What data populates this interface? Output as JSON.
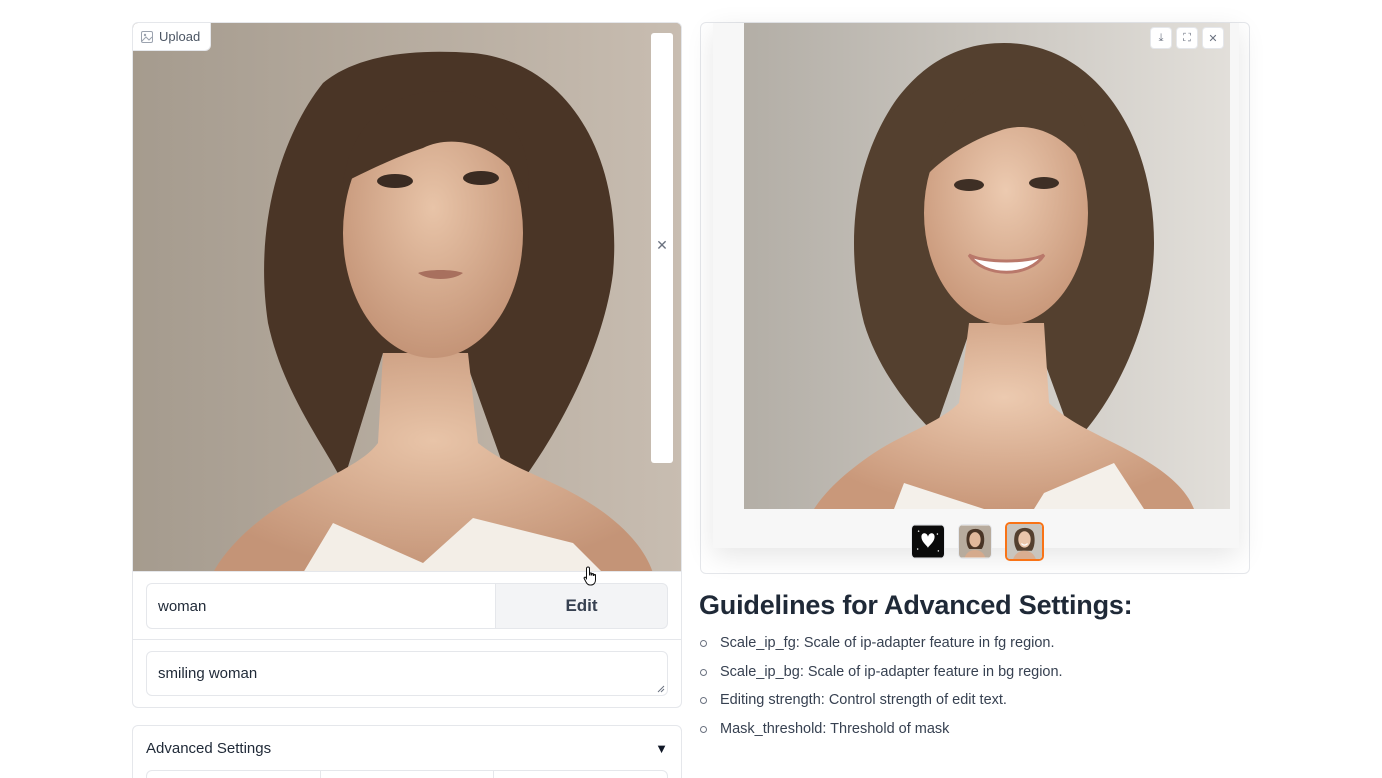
{
  "input_image": {
    "upload_label": "Upload",
    "upload_icon": "image-icon",
    "clear_icon": "close-icon"
  },
  "edit": {
    "source_value": "woman",
    "button_label": "Edit"
  },
  "target_prompt": {
    "value": "smiling woman"
  },
  "advanced_settings": {
    "label": "Advanced Settings",
    "toggle_icon": "▼"
  },
  "gallery": {
    "toolbar": [
      "download-icon",
      "fullscreen-icon",
      "close-icon"
    ],
    "thumbnails": [
      "mask-thumbnail",
      "source-thumbnail",
      "result-thumbnail"
    ],
    "selected_index": 2,
    "accent": "#f97316"
  },
  "guidelines": {
    "title": "Guidelines for Advanced Settings:",
    "items": [
      "Scale_ip_fg: Scale of ip-adapter feature in fg region.",
      "Scale_ip_bg: Scale of ip-adapter feature in bg region.",
      "Editing strength: Control strength of edit text.",
      "Mask_threshold: Threshold of mask"
    ]
  }
}
